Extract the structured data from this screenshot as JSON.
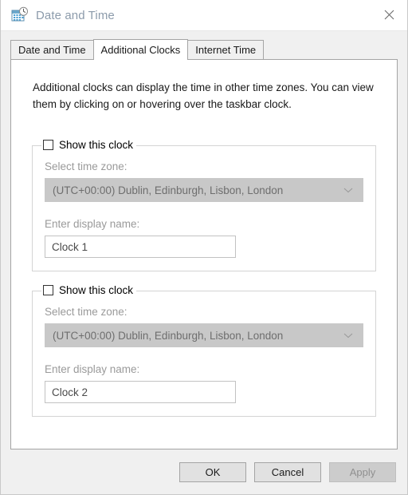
{
  "window": {
    "title": "Date and Time",
    "icon": "date-time-calendar-clock-icon",
    "close_label": "✕"
  },
  "tabs": [
    {
      "label": "Date and Time",
      "active": false
    },
    {
      "label": "Additional Clocks",
      "active": true
    },
    {
      "label": "Internet Time",
      "active": false
    }
  ],
  "content": {
    "description": "Additional clocks can display the time in other time zones. You can view them by clicking on or hovering over the taskbar clock.",
    "clocks": [
      {
        "show_label": "Show this clock",
        "checked": false,
        "timezone_label": "Select time zone:",
        "timezone_value": "(UTC+00:00) Dublin, Edinburgh, Lisbon, London",
        "display_name_label": "Enter display name:",
        "display_name_value": "Clock 1",
        "display_name_placeholder": "Clock 1"
      },
      {
        "show_label": "Show this clock",
        "checked": false,
        "timezone_label": "Select time zone:",
        "timezone_value": "(UTC+00:00) Dublin, Edinburgh, Lisbon, London",
        "display_name_label": "Enter display name:",
        "display_name_value": "Clock 2",
        "display_name_placeholder": "Clock 2"
      }
    ]
  },
  "buttons": {
    "ok": "OK",
    "cancel": "Cancel",
    "apply": "Apply"
  },
  "colors": {
    "dialog_bg": "#f0f0f0",
    "panel_bg": "#ffffff",
    "title_text": "#8c9bab",
    "disabled_text": "#9a9a9a",
    "combo_disabled_bg": "#c8c8c8",
    "accent_icon": "#4a9fd4"
  }
}
